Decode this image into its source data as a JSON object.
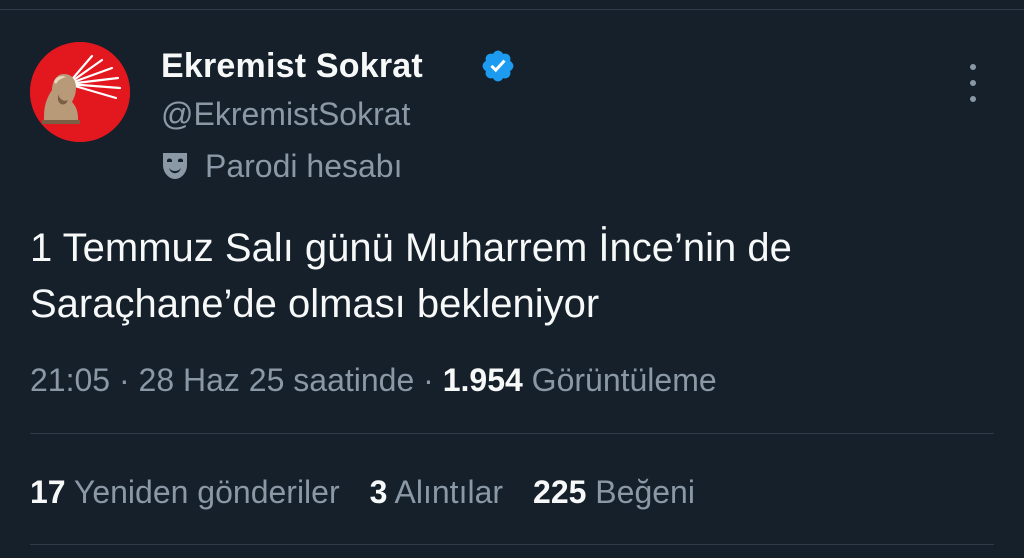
{
  "colors": {
    "background": "#15202b",
    "primary_text": "#f7f9f9",
    "secondary_text": "#8b98a5",
    "divider": "#2f3b47",
    "verified_badge": "#1d9bf0",
    "avatar_background": "#e3171e"
  },
  "author": {
    "display_name": "Ekremist Sokrat",
    "handle": "@EkremistSokrat",
    "verified": true,
    "verified_icon": "verified-badge-icon",
    "avatar_icon": "avatar-image",
    "parody_icon": "theater-mask-icon",
    "parody_label": "Parodi hesabı"
  },
  "more_icon": "more-options-icon",
  "tweet": {
    "text": "1 Temmuz Salı günü Muharrem İnce’nin de Saraçhane’de olması bekleniyor",
    "time": "21:05",
    "date": "28 Haz 25 saatinde",
    "separator": "·",
    "views_count": "1.954",
    "views_label": "Görüntüleme"
  },
  "stats": [
    {
      "count": "17",
      "label": "Yeniden gönderiler"
    },
    {
      "count": "3",
      "label": "Alıntılar"
    },
    {
      "count": "225",
      "label": "Beğeni"
    }
  ]
}
